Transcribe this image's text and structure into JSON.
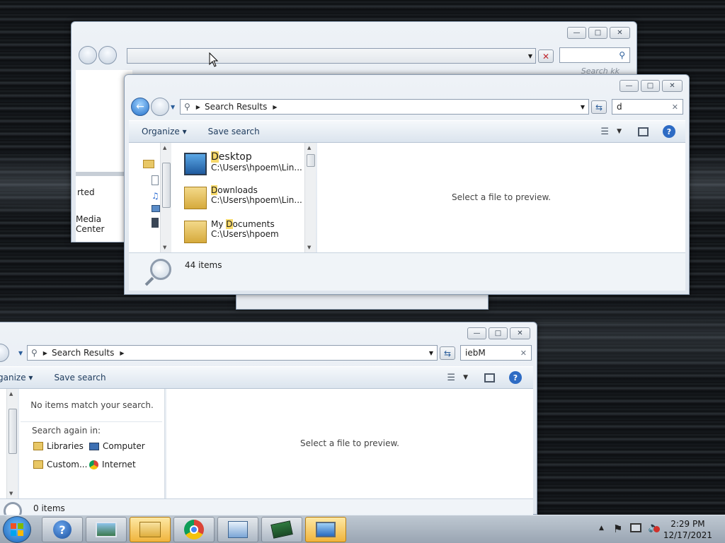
{
  "win_back": {
    "search_placeholder": "Search kk",
    "sidebar_items": [
      "rted",
      "Media Center"
    ]
  },
  "win_front": {
    "breadcrumb": "Search Results",
    "search_value": "d",
    "toolbar": {
      "organize": "Organize",
      "save_search": "Save search"
    },
    "results": [
      {
        "name_hl": "D",
        "name_rest": "esktop",
        "path": "C:\\Users\\hpoem\\Lin...",
        "icon": "desktop-icon"
      },
      {
        "name_hl": "D",
        "name_rest": "ownloads",
        "path": "C:\\Users\\hpoem\\Lin...",
        "icon": "downloads-folder-icon"
      },
      {
        "name_pre": "My ",
        "name_hl": "D",
        "name_rest": "ocuments",
        "path": "C:\\Users\\hpoem",
        "icon": "documents-folder-icon"
      }
    ],
    "preview_text": "Select a file to preview.",
    "status_count": "44 items"
  },
  "win_bottom": {
    "breadcrumb": "Search Results",
    "search_value": "iebM",
    "toolbar": {
      "organize": "ganize",
      "save_search": "Save search"
    },
    "no_items": "No items match your search.",
    "search_again_label": "Search again in:",
    "search_again": [
      {
        "label": "Libraries",
        "icon": "libraries-icon"
      },
      {
        "label": "Computer",
        "icon": "computer-icon"
      },
      {
        "label": "Custom...",
        "icon": "folder-icon"
      },
      {
        "label": "Internet",
        "icon": "chrome-icon"
      }
    ],
    "preview_text": "Select a file to preview.",
    "status_count": "0 items"
  },
  "taskbar": {
    "apps": [
      "help-icon",
      "photo-viewer-icon",
      "file-explorer-icon",
      "chrome-icon",
      "control-panel-icon",
      "network-card-icon",
      "remote-desktop-icon"
    ],
    "clock_time": "2:29 PM",
    "clock_date": "12/17/2021"
  },
  "colors": {
    "highlight": "#f7d96a",
    "accent": "#2470c9",
    "taskbar_active": "#f0b43c"
  }
}
